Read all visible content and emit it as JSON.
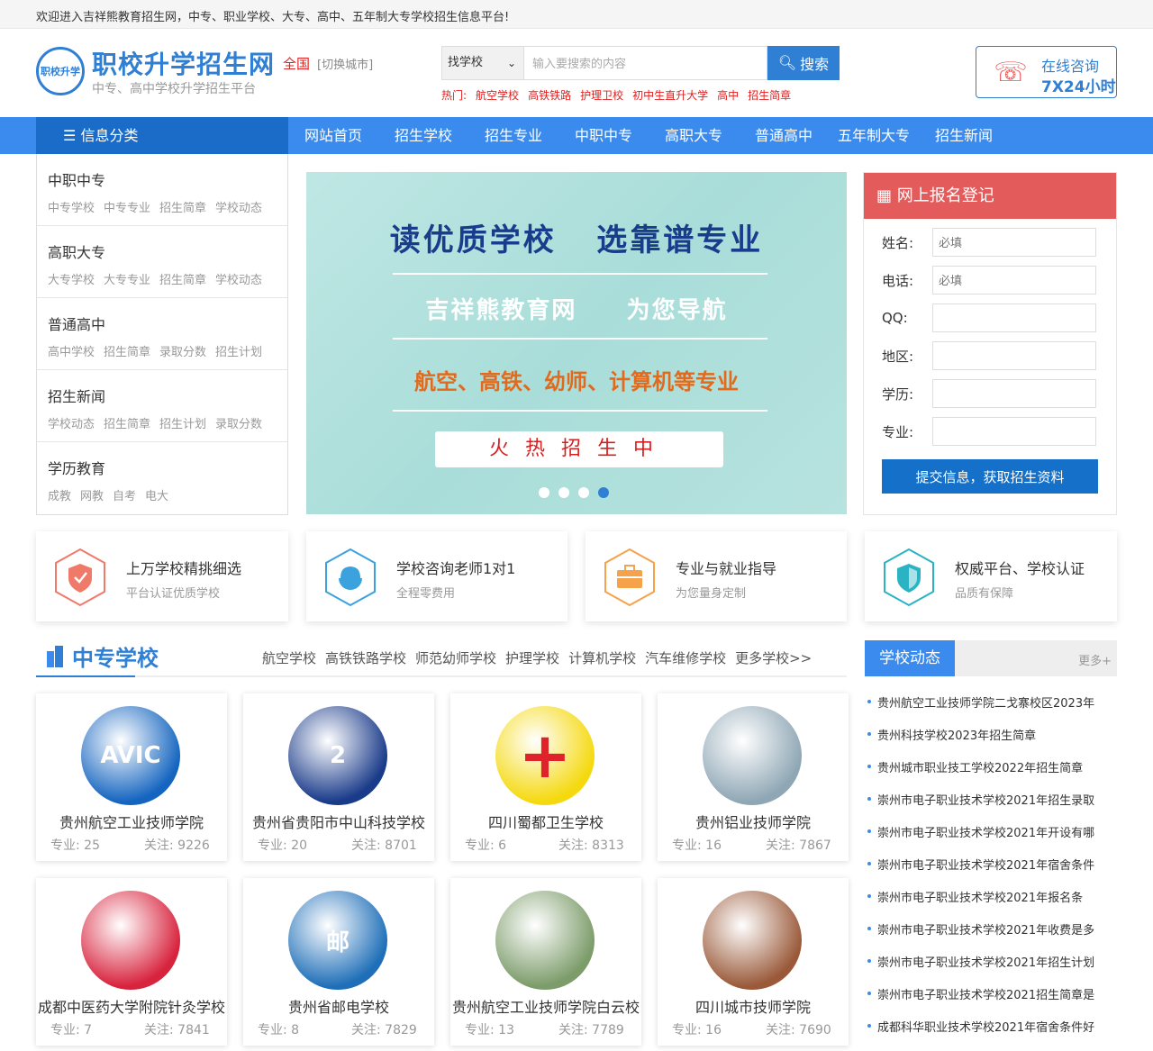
{
  "topbar": {
    "welcome": "欢迎进入吉祥熊教育招生网，中专、职业学校、大专、高中、五年制大专学校招生信息平台!"
  },
  "header": {
    "logo_mark": "职校升学",
    "logo_title": "职校升学招生网",
    "logo_subtitle": "中专、高中学校升学招生平台",
    "city": "全国",
    "city_switch": "[切换城市]",
    "search": {
      "select_value": "找学校",
      "placeholder": "输入要搜索的内容",
      "button": "搜索"
    },
    "hot": {
      "label": "热门:",
      "items": [
        "航空学校",
        "高铁铁路",
        "护理卫校",
        "初中生直升大学",
        "高中",
        "招生简章"
      ]
    },
    "consult": {
      "line1": "在线咨询",
      "line2": "7X24小时"
    }
  },
  "nav": {
    "category": "信息分类",
    "items": [
      "网站首页",
      "招生学校",
      "招生专业",
      "中职中专",
      "高职大专",
      "普通高中",
      "五年制大专",
      "招生新闻"
    ]
  },
  "sidebar": [
    {
      "title": "中职中专",
      "links": [
        "中专学校",
        "中专专业",
        "招生简章",
        "学校动态"
      ]
    },
    {
      "title": "高职大专",
      "links": [
        "大专学校",
        "大专专业",
        "招生简章",
        "学校动态"
      ]
    },
    {
      "title": "普通高中",
      "links": [
        "高中学校",
        "招生简章",
        "录取分数",
        "招生计划"
      ]
    },
    {
      "title": "招生新闻",
      "links": [
        "学校动态",
        "招生简章",
        "招生计划",
        "录取分数"
      ]
    },
    {
      "title": "学历教育",
      "links": [
        "成教",
        "网教",
        "自考",
        "电大"
      ]
    }
  ],
  "banner": {
    "line1a": "读优质学校",
    "line1b": "选靠谱专业",
    "line2a": "吉祥熊教育网",
    "line2b": "为您导航",
    "line3": "航空、高铁、幼师、计算机等专业",
    "box": "火热招生中"
  },
  "register": {
    "title": "网上报名登记",
    "fields": [
      {
        "label": "姓名:",
        "placeholder": "必填"
      },
      {
        "label": "电话:",
        "placeholder": "必填"
      },
      {
        "label": "QQ:",
        "placeholder": ""
      },
      {
        "label": "地区:",
        "placeholder": ""
      },
      {
        "label": "学历:",
        "placeholder": ""
      },
      {
        "label": "专业:",
        "placeholder": ""
      }
    ],
    "button": "提交信息，获取招生资料"
  },
  "features": [
    {
      "title": "上万学校精挑细选",
      "sub": "平台认证优质学校",
      "icon": "shield-icon",
      "color": "#f07a6a"
    },
    {
      "title": "学校咨询老师1对1",
      "sub": "全程零费用",
      "icon": "headset-icon",
      "color": "#3ba2de"
    },
    {
      "title": "专业与就业指导",
      "sub": "为您量身定制",
      "icon": "briefcase-icon",
      "color": "#f5a24a"
    },
    {
      "title": "权威平台、学校认证",
      "sub": "品质有保障",
      "icon": "badge-icon",
      "color": "#2bb3c4"
    }
  ],
  "schools_section": {
    "title": "中专学校",
    "links": [
      "航空学校",
      "高铁铁路学校",
      "师范幼师学校",
      "护理学校",
      "计算机学校",
      "汽车维修学校",
      "更多学校>>"
    ]
  },
  "schools": [
    {
      "name": "贵州航空工业技师学院",
      "majors_label": "专业: 25",
      "follow_label": "关注: 9226",
      "img_text": "AVIC",
      "bg": "#1565c0"
    },
    {
      "name": "贵州省贵阳市中山科技学校",
      "majors_label": "专业: 20",
      "follow_label": "关注: 8701",
      "img_text": "2",
      "bg": "#1a3b8a"
    },
    {
      "name": "四川蜀都卫生学校",
      "majors_label": "专业: 6",
      "follow_label": "关注: 8313",
      "img_text": "+",
      "bg": "#f5d90f"
    },
    {
      "name": "贵州铝业技师学院",
      "majors_label": "专业: 16",
      "follow_label": "关注: 7867",
      "img_text": "",
      "bg": "#8fa7b5"
    },
    {
      "name": "成都中医药大学附院针灸学校",
      "majors_label": "专业: 7",
      "follow_label": "关注: 7841",
      "img_text": "",
      "bg": "#d8233d"
    },
    {
      "name": "贵州省邮电学校",
      "majors_label": "专业: 8",
      "follow_label": "关注: 7829",
      "img_text": "邮",
      "bg": "#1f6fb8"
    },
    {
      "name": "贵州航空工业技师学院白云校",
      "majors_label": "专业: 13",
      "follow_label": "关注: 7789",
      "img_text": "",
      "bg": "#7c9c6a"
    },
    {
      "name": "四川城市技师学院",
      "majors_label": "专业: 16",
      "follow_label": "关注: 7690",
      "img_text": "",
      "bg": "#9a5a3a"
    }
  ],
  "dynamics": {
    "title": "学校动态",
    "more": "更多+",
    "items": [
      "贵州航空工业技师学院二戈寨校区2023年",
      "贵州科技学校2023年招生简章",
      "贵州城市职业技工学校2022年招生简章",
      "崇州市电子职业技术学校2021年招生录取",
      "崇州市电子职业技术学校2021年开设有哪",
      "崇州市电子职业技术学校2021年宿舍条件",
      "崇州市电子职业技术学校2021年报名条",
      "崇州市电子职业技术学校2021年收费是多",
      "崇州市电子职业技术学校2021年招生计划",
      "崇州市电子职业技术学校2021招生简章是",
      "成都科华职业技术学校2021年宿舍条件好"
    ]
  }
}
